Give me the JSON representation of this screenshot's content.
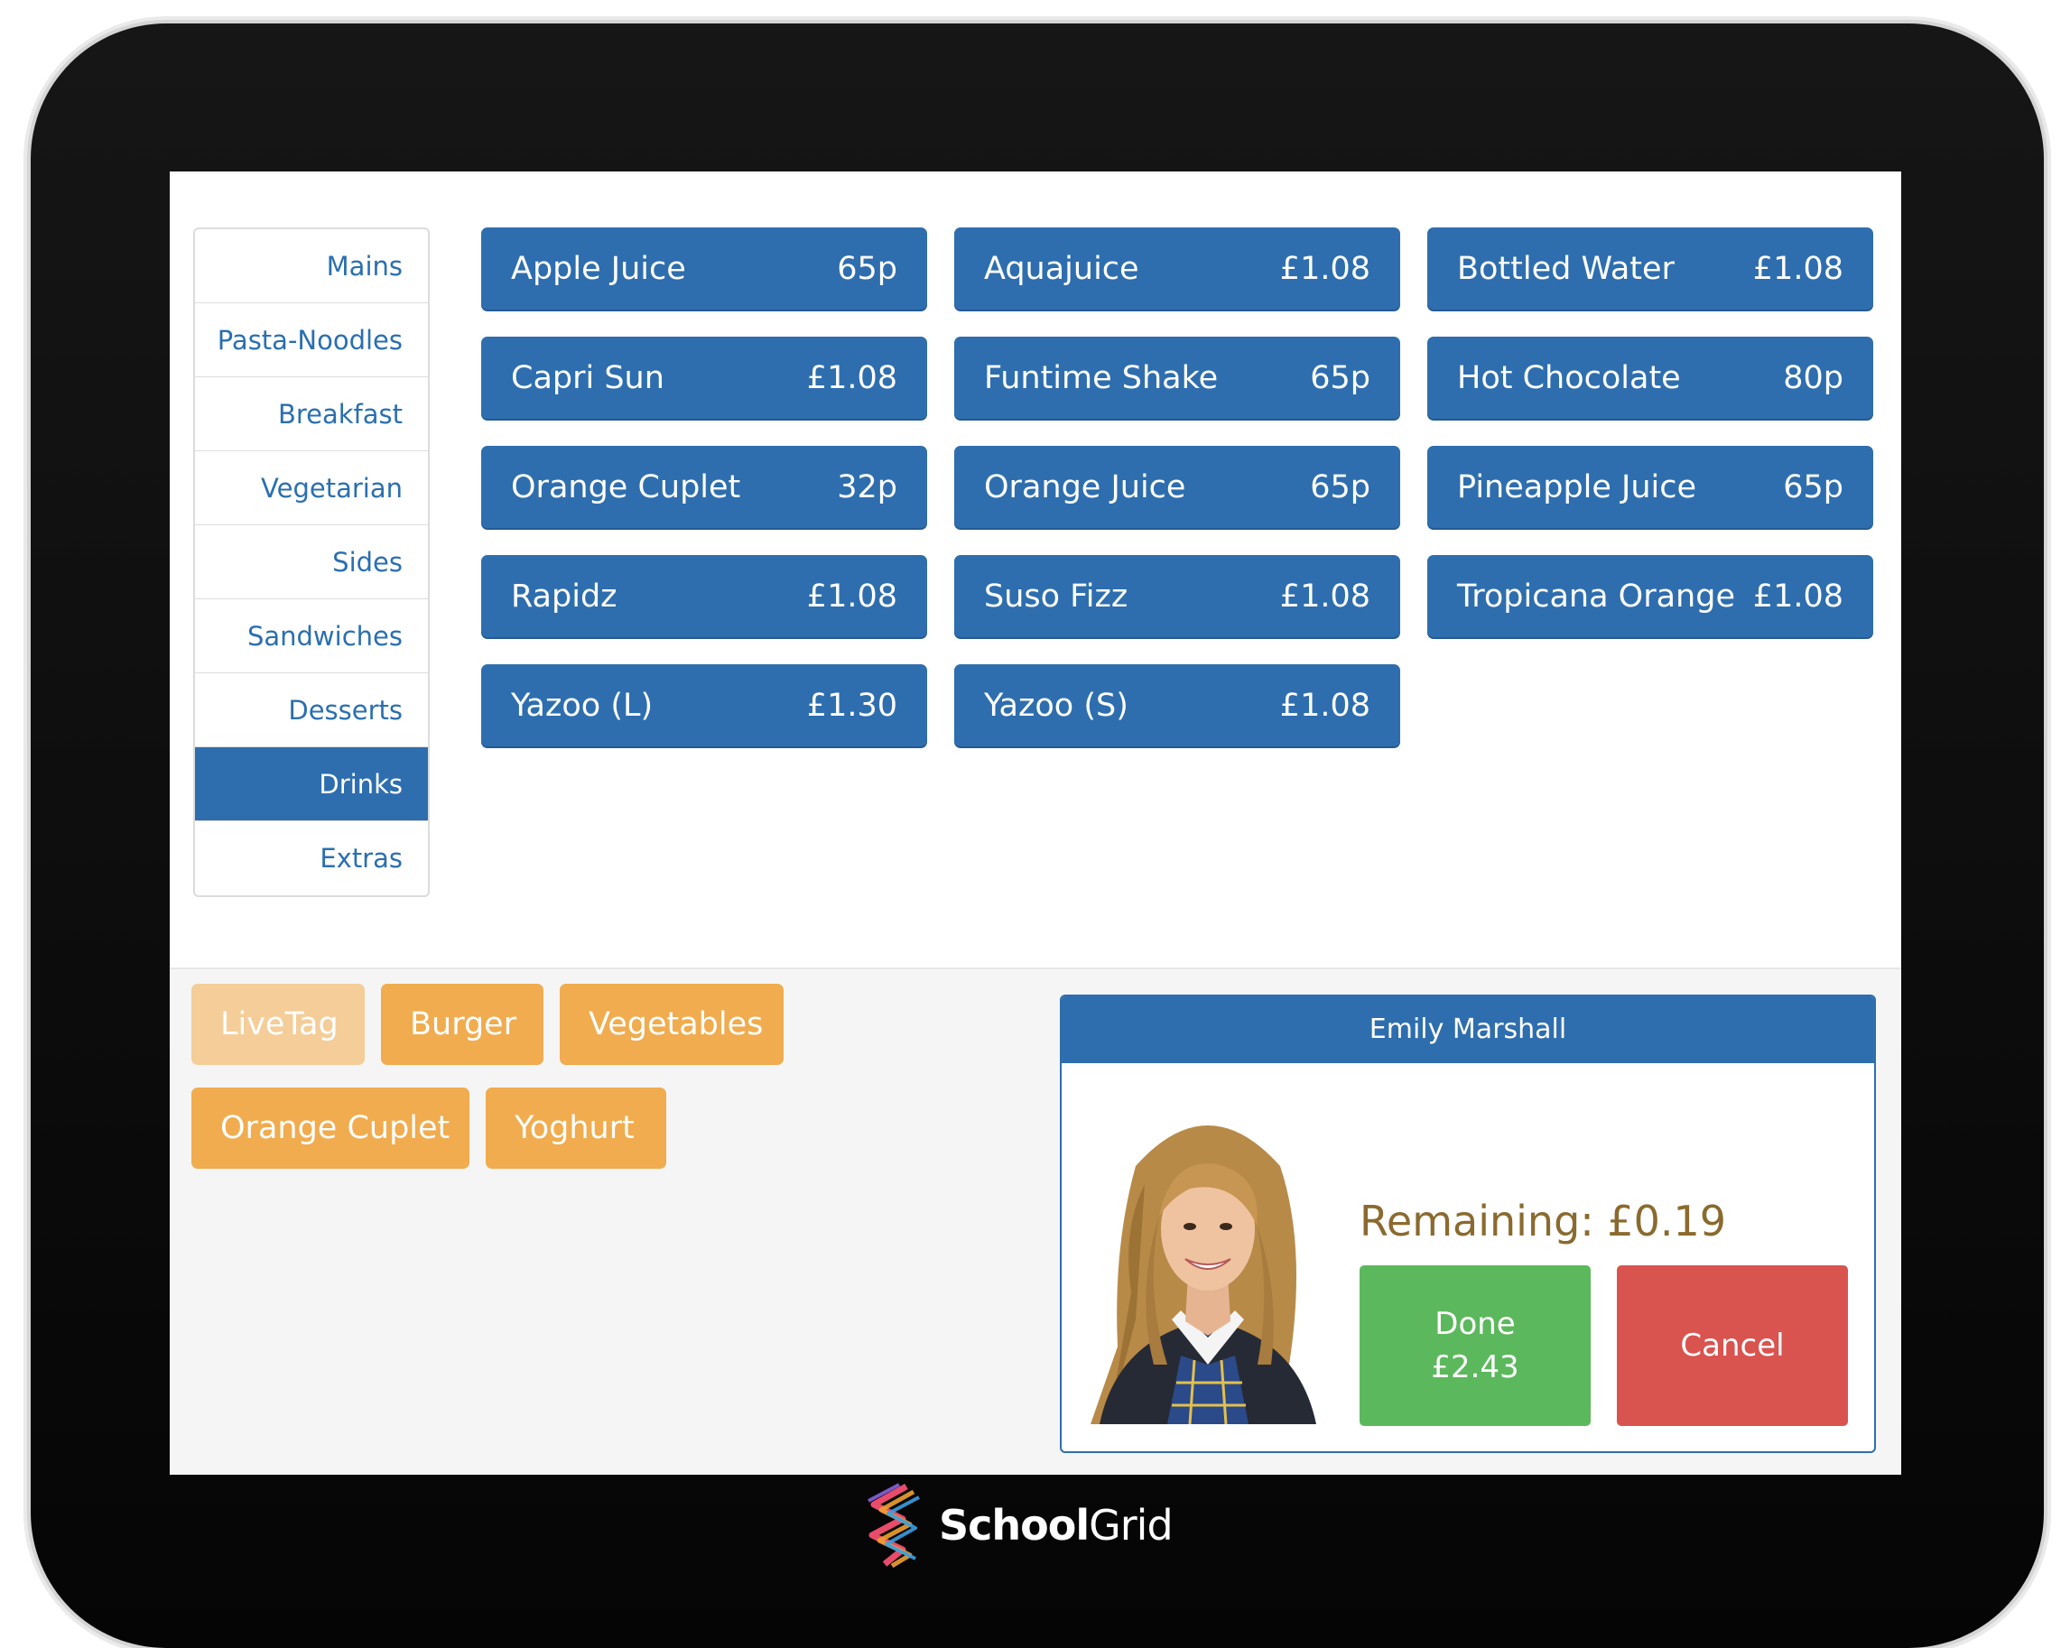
{
  "categories": [
    {
      "label": "Mains",
      "active": false
    },
    {
      "label": "Pasta-Noodles",
      "active": false
    },
    {
      "label": "Breakfast",
      "active": false
    },
    {
      "label": "Vegetarian",
      "active": false
    },
    {
      "label": "Sides",
      "active": false
    },
    {
      "label": "Sandwiches",
      "active": false
    },
    {
      "label": "Desserts",
      "active": false
    },
    {
      "label": "Drinks",
      "active": true
    },
    {
      "label": "Extras",
      "active": false
    }
  ],
  "products": [
    {
      "name": "Apple Juice",
      "price": "65p"
    },
    {
      "name": "Aquajuice",
      "price": "£1.08"
    },
    {
      "name": "Bottled Water",
      "price": "£1.08"
    },
    {
      "name": "Capri Sun",
      "price": "£1.08"
    },
    {
      "name": "Funtime Shake",
      "price": "65p"
    },
    {
      "name": "Hot Chocolate",
      "price": "80p"
    },
    {
      "name": "Orange Cuplet",
      "price": "32p"
    },
    {
      "name": "Orange Juice",
      "price": "65p"
    },
    {
      "name": "Pineapple Juice",
      "price": "65p"
    },
    {
      "name": "Rapidz",
      "price": "£1.08"
    },
    {
      "name": "Suso Fizz",
      "price": "£1.08"
    },
    {
      "name": "Tropicana Orange",
      "price": "£1.08"
    },
    {
      "name": "Yazoo (L)",
      "price": "£1.30"
    },
    {
      "name": "Yazoo (S)",
      "price": "£1.08"
    }
  ],
  "tags": [
    {
      "label": "LiveTag"
    },
    {
      "label": "Burger"
    },
    {
      "label": "Vegetables"
    },
    {
      "label": "Orange Cuplet"
    },
    {
      "label": "Yoghurt"
    }
  ],
  "student": {
    "name": "Emily Marshall",
    "remaining": "Remaining: £0.19"
  },
  "actions": {
    "done_label": "Done",
    "done_amount": "£2.43",
    "cancel_label": "Cancel"
  },
  "brand": {
    "bold": "School",
    "light": "Grid"
  },
  "colors": {
    "primary_blue": "#2e6eae",
    "tag_orange": "#f0ac4e",
    "tag_orange_dim": "#f4cd98",
    "done_green": "#5cb85c",
    "cancel_red": "#d9534f",
    "remaining_text": "#8a6a2e"
  }
}
